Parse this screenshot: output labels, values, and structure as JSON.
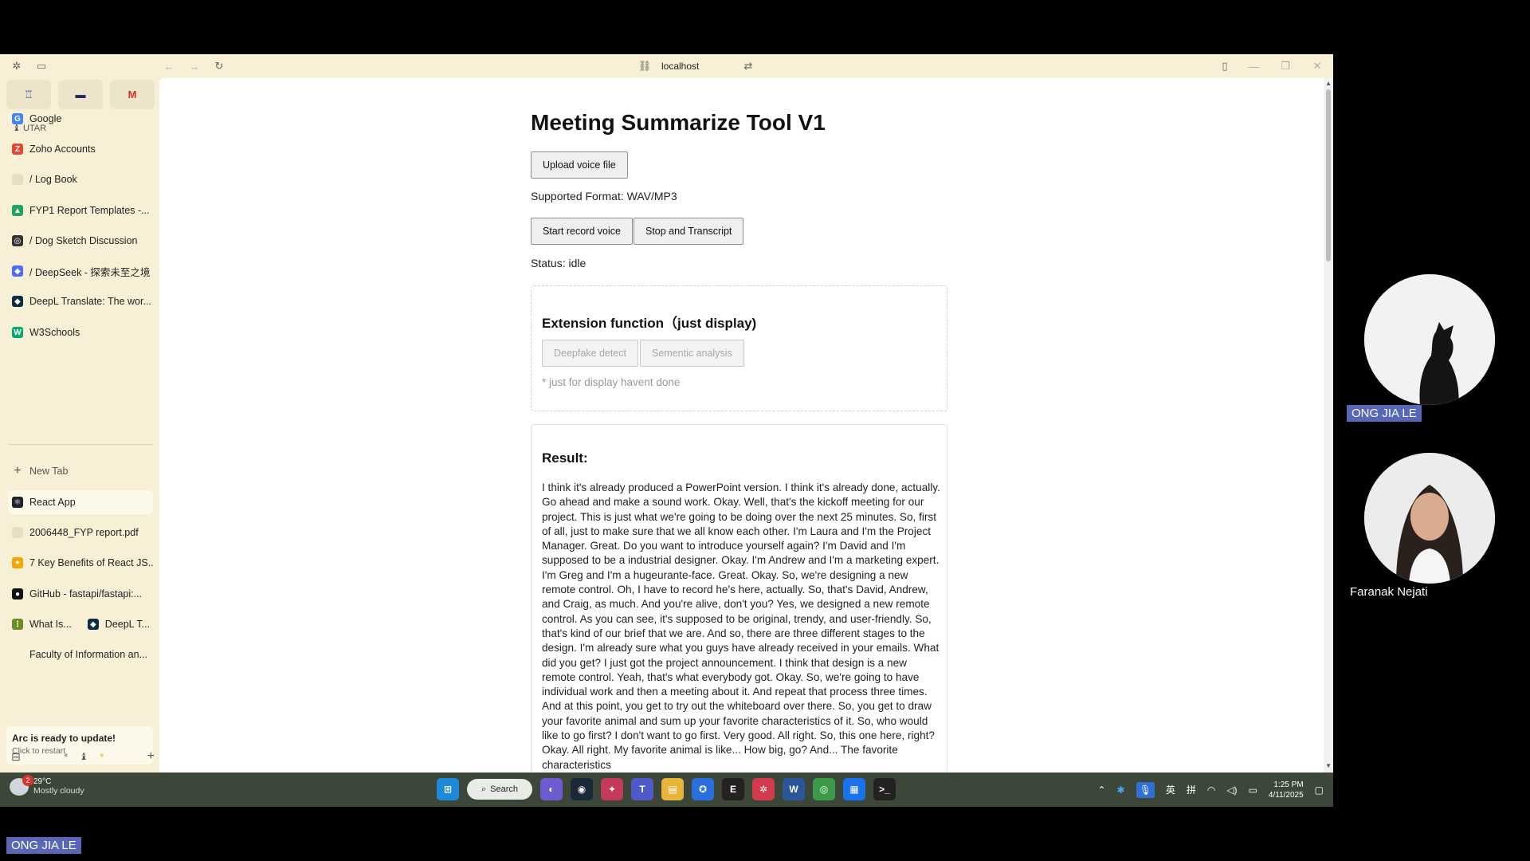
{
  "browser": {
    "url": "localhost"
  },
  "sidebar": {
    "space_label": "UTAR",
    "pinned_tabs": [
      {
        "icon": "trophy-icon"
      },
      {
        "icon": "flag-icon"
      },
      {
        "icon": "gmail-icon",
        "glyph": "M"
      }
    ],
    "favorites": [
      {
        "label": "Google",
        "glyph": "G",
        "color": "#4285f4"
      },
      {
        "label": "Zoho Accounts",
        "glyph": "Z",
        "color": "#e6462e"
      },
      {
        "label": "/  Log Book",
        "glyph": "",
        "color": "#e6dfc6"
      },
      {
        "label": "FYP1 Report Templates -...",
        "glyph": "▲",
        "color": "#1fa463"
      },
      {
        "label": "/  Dog Sketch Discussion",
        "glyph": "◎",
        "color": "#333333"
      },
      {
        "label": "/  DeepSeek - 探索未至之境",
        "glyph": "◆",
        "color": "#4d6bfe"
      },
      {
        "label": "DeepL Translate: The wor...",
        "glyph": "◆",
        "color": "#0f2b46"
      },
      {
        "label": "W3Schools",
        "glyph": "W",
        "color": "#04aa6d"
      }
    ],
    "new_tab_label": "New Tab",
    "tabs": [
      {
        "label": "React App",
        "glyph": "⚛",
        "color": "#20232a",
        "active": true
      },
      {
        "label": "2006448_FYP report.pdf",
        "glyph": "",
        "color": "#e6dfc6",
        "active": false
      },
      {
        "label": "7 Key Benefits of React JS...",
        "glyph": "✦",
        "color": "#f2a600",
        "active": false
      },
      {
        "label": "GitHub - fastapi/fastapi:...",
        "glyph": "●",
        "color": "#111111",
        "active": false
      },
      {
        "label": "What Is...",
        "glyph": "⋮",
        "color": "#6b8e23",
        "active": false,
        "split_label": "DeepL T..."
      },
      {
        "label": "Faculty of Information an...",
        "glyph": "",
        "color": "#f7f0d6",
        "active": false
      }
    ],
    "update_title": "Arc is ready to update!",
    "update_subtitle": "Click to restart"
  },
  "app": {
    "title": "Meeting Summarize Tool V1",
    "upload_label": "Upload voice file",
    "supported_format": "Supported Format: WAV/MP3",
    "start_label": "Start record voice",
    "stop_label": "Stop and Transcript",
    "status": "Status: idle",
    "extension": {
      "title": "Extension function（just display)",
      "deepfake_label": "Deepfake detect",
      "semantic_label": "Sementic analysis",
      "note": "* just for display havent done"
    },
    "result": {
      "title": "Result:",
      "text": " I think it's already produced a PowerPoint version. I think it's already done, actually. Go ahead and make a sound work. Okay. Well, that's the kickoff meeting for our project. This is just what we're going to be doing over the next 25 minutes. So, first of all, just to make sure that we all know each other. I'm Laura and I'm the Project Manager. Great. Do you want to introduce yourself again? I'm David and I'm supposed to be a industrial designer. Okay. I'm Andrew and I'm a marketing expert. I'm Greg and I'm a hugeurante-face. Great. Okay. So, we're designing a new remote control. Oh, I have to record he's here, actually. So, that's David, Andrew, and Craig, as much. And you're alive, don't you? Yes, we designed a new remote control. As you can see, it's supposed to be original, trendy, and user-friendly. So, that's kind of our brief that we are. And so, there are three different stages to the design. I'm already sure what you guys have already received in your emails. What did you get? I just got the project announcement. I think that design is a new remote control. Yeah, that's what everybody got. Okay. So, we're going to have individual work and then a meeting about it. And repeat that process three times. And at this point, you get to try out the whiteboard over there. So, you get to draw your favorite animal and sum up your favorite characteristics of it. So, who would like to go first? I don't want to go first. Very good. All right. So, this one here, right? Okay. All right. My favorite animal is like... How big, go? And... The favorite characteristics"
    }
  },
  "taskbar": {
    "weather_badge": "2",
    "temperature": "29°C",
    "condition": "Mostly cloudy",
    "search_label": "Search",
    "ime_label": "英",
    "ime_label2": "拼",
    "time": "1:25 PM",
    "date": "4/11/2025"
  },
  "participants": [
    {
      "name": "ONG JIA LE"
    },
    {
      "name": "Faranak Nejati"
    }
  ],
  "bottom_name_tag": "ONG JIA LE"
}
